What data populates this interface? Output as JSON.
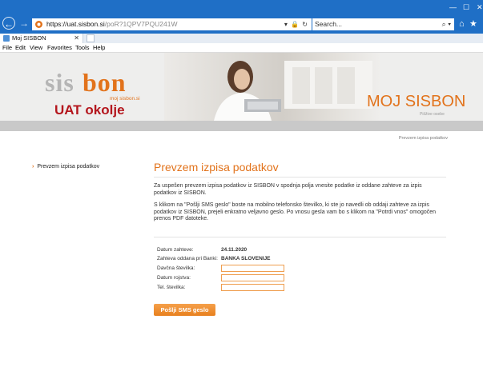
{
  "browser": {
    "url_host": "https://uat.sisbon.si",
    "url_path": "/poR?1QPV7PQU241W",
    "search_placeholder": "Search...",
    "tab_title": "Moj SISBON",
    "menu": [
      "File",
      "Edit",
      "View",
      "Favorites",
      "Tools",
      "Help"
    ],
    "accent_color": "#1f6fc6"
  },
  "header": {
    "logo_sis": "sis",
    "logo_bon": "bon",
    "logo_sub": "moj sisbon.si",
    "environment": "UAT okolje",
    "site_title": "MOJ SISBON",
    "site_subtitle": "Pišžive osebe"
  },
  "breadcrumb": "Prevzem izpisa podatkov",
  "sidebar": {
    "items": [
      {
        "label": "Prevzem izpisa podatkov"
      }
    ]
  },
  "main": {
    "title": "Prevzem izpisa podatkov",
    "intro": "Za uspešen prevzem izpisa podatkov iz SISBON v spodnja polja vnesite podatke iz oddane zahteve za izpis podatkov iz SISBON.",
    "instructions": "S klikom na \"Pošlji SMS geslo\" boste na mobilno telefonsko številko, ki ste jo navedli ob oddaji zahteve za izpis podatkov iz SISBON, prejeli enkratno veljavno geslo. Po vnosu gesla vam bo s klikom na \"Potrdi vnos\" omogočen prenos PDF datoteke."
  },
  "form": {
    "date_label": "Datum zahteve:",
    "date_value": "24.11.2020",
    "bank_label": "Zahteva oddana pri Banki:",
    "bank_value": "BANKA SLOVENIJE",
    "tax_label": "Davčna številka:",
    "tax_value": "",
    "birth_label": "Datum rojstva:",
    "birth_value": "",
    "phone_label": "Tel. številka:",
    "phone_value": "",
    "submit_label": "Pošlji SMS geslo"
  },
  "colors": {
    "brand_orange": "#e2731c",
    "env_red": "#b4161d",
    "field_border": "#ef9e4f"
  }
}
